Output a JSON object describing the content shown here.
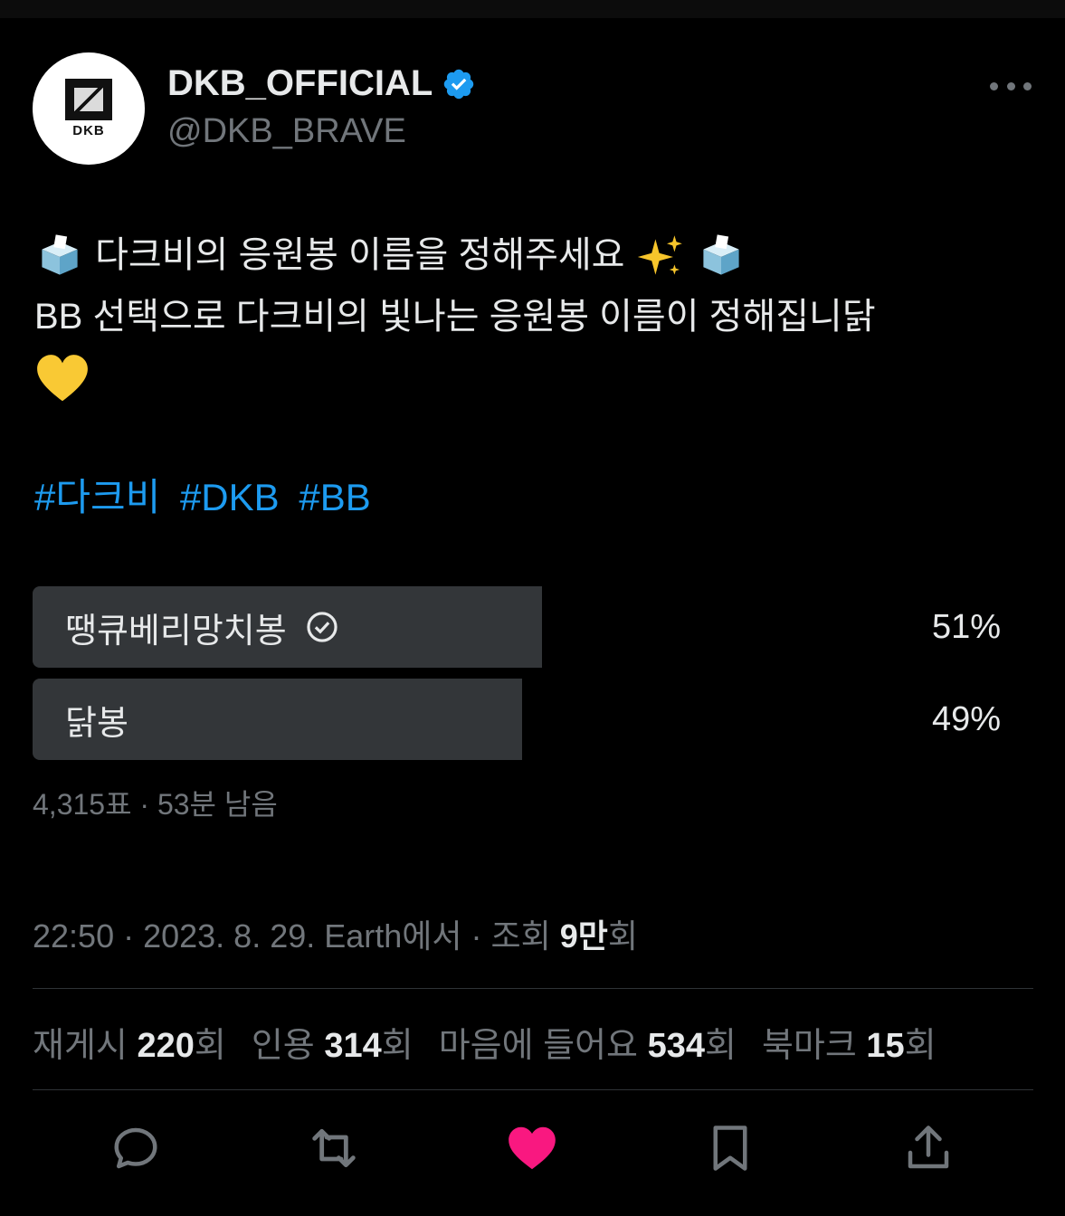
{
  "account": {
    "display_name": "DKB_OFFICIAL",
    "handle": "@DKB_BRAVE",
    "avatar_text": "DKB"
  },
  "tweet": {
    "line1": "다크비의 응원봉 이름을 정해주세요",
    "line2": "BB 선택으로 다크비의 빛나는 응원봉 이름이 정해집니닭",
    "hashtags": [
      "#다크비",
      "#DKB",
      "#BB"
    ]
  },
  "poll": {
    "options": [
      {
        "label": "땡큐베리망치봉",
        "percent_text": "51%",
        "percent": 51,
        "voted": true
      },
      {
        "label": "닭봉",
        "percent_text": "49%",
        "percent": 49,
        "voted": false
      }
    ],
    "meta": "4,315표 · 53분 남음"
  },
  "timestamp": {
    "text": "22:50 · 2023. 8. 29. Earth에서 · 조회 ",
    "views": "9만",
    "suffix": "회"
  },
  "stats": {
    "retweets_label": "재게시",
    "retweets": "220",
    "retweets_unit": "회",
    "quotes_label": "인용",
    "quotes": "314",
    "quotes_unit": "회",
    "likes_label": "마음에 들어요",
    "likes": "534",
    "likes_unit": "회",
    "bookmarks_label": "북마크",
    "bookmarks": "15",
    "bookmarks_unit": "회"
  },
  "colors": {
    "accent": "#1d9bf0",
    "like": "#f91880",
    "bar": "#333639",
    "muted": "#71767b"
  }
}
